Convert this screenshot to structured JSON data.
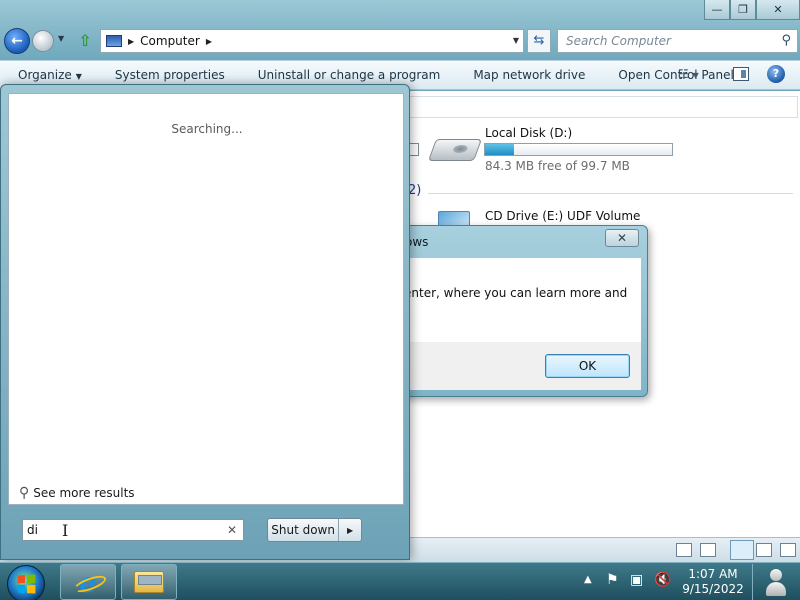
{
  "explorer": {
    "title_controls": {
      "minimize": "—",
      "maximize": "❐",
      "close": "✕"
    },
    "address": {
      "location": "Computer"
    },
    "search": {
      "placeholder": "Search Computer"
    },
    "commands": [
      {
        "label": "Organize",
        "has_menu": true
      },
      {
        "label": "System properties"
      },
      {
        "label": "Uninstall or change a program"
      },
      {
        "label": "Map network drive"
      },
      {
        "label": "Open Control Panel"
      }
    ],
    "group_count_partial": "2)",
    "drives": [
      {
        "name": "Local Disk (D:)",
        "free_text": "84.3 MB free of 99.7 MB",
        "used_fraction": 0.155,
        "icon": "hard-drive-icon"
      },
      {
        "name": "CD Drive (E:) UDF Volume",
        "icon": "cd-drive-icon"
      }
    ]
  },
  "dialog": {
    "title_partial": "ows",
    "close_label": "✕",
    "message_partial": "enter, where you can learn more and",
    "ok_label": "OK"
  },
  "start_menu": {
    "status": "Searching...",
    "see_more": "See more results",
    "search_value": "di",
    "clear_icon": "✕",
    "shutdown_label": "Shut down",
    "shutdown_arrow": "▶"
  },
  "taskbar": {
    "pinned": [
      {
        "name": "internet-explorer-icon"
      },
      {
        "name": "windows-explorer-icon"
      }
    ],
    "clock_time": "1:07 AM",
    "clock_date": "9/15/2022"
  },
  "colors": {
    "accent": "#1f8fc6",
    "titlebar": "#9cc8d6",
    "taskbar": "#2c6a7e"
  }
}
